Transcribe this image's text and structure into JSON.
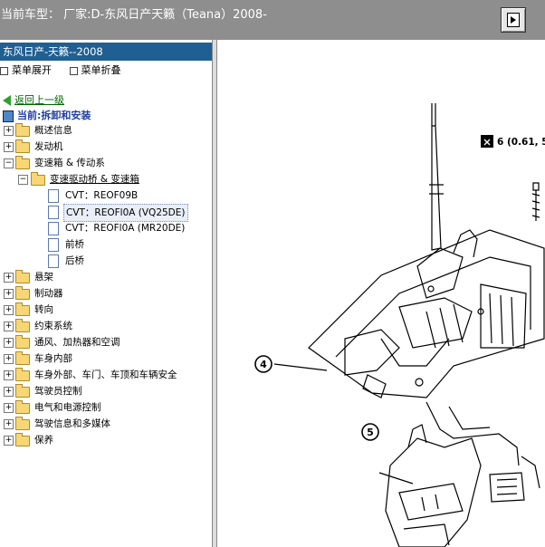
{
  "window": {
    "title": "当前车型： 厂家:D-东风日产天籁（Teana）2008-"
  },
  "sidebar": {
    "header": "东风日产-天籁--2008",
    "expand_all": "菜单展开",
    "collapse_all": "菜单折叠",
    "back_link": "返回上一级",
    "current": "当前:拆卸和安装",
    "items": [
      {
        "label": "概述信息",
        "pm": "+"
      },
      {
        "label": "发动机",
        "pm": "+"
      },
      {
        "label": "变速箱 & 传动系",
        "pm": "−"
      },
      {
        "label": "变速驱动桥 & 变速箱",
        "pm": "−"
      },
      {
        "label": "CVT：REOF09B"
      },
      {
        "label": "CVT：REOFl0A (VQ25DE)"
      },
      {
        "label": "CVT：REOFl0A (MR20DE)"
      },
      {
        "label": "前桥"
      },
      {
        "label": "后桥"
      },
      {
        "label": "悬架",
        "pm": "+"
      },
      {
        "label": "制动器",
        "pm": "+"
      },
      {
        "label": "转向",
        "pm": "+"
      },
      {
        "label": "约束系统",
        "pm": "+"
      },
      {
        "label": "通风、加热器和空调",
        "pm": "+"
      },
      {
        "label": "车身内部",
        "pm": "+"
      },
      {
        "label": "车身外部、车门、车顶和车辆安全",
        "pm": "+"
      },
      {
        "label": "驾驶员控制",
        "pm": "+"
      },
      {
        "label": "电气和电源控制",
        "pm": "+"
      },
      {
        "label": "驾驶信息和多媒体",
        "pm": "+"
      },
      {
        "label": "保养",
        "pm": "+"
      }
    ]
  },
  "diagram": {
    "torque_label": "6 (0.61, 5",
    "callout_4": "4",
    "callout_5": "5"
  }
}
